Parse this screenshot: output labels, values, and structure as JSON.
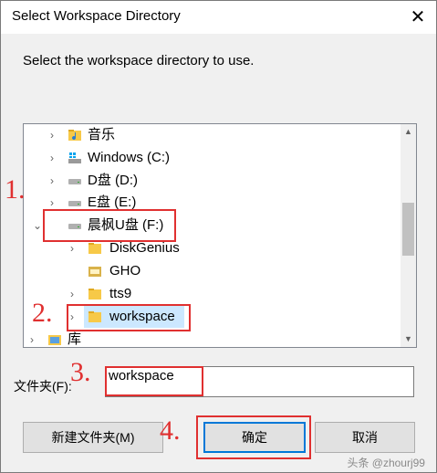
{
  "window": {
    "title": "Select Workspace Directory",
    "close_glyph": "✕"
  },
  "prompt": "Select the workspace directory to use.",
  "tree": {
    "items": [
      {
        "label": "音乐",
        "icon": "music-folder-icon",
        "chevron": "›"
      },
      {
        "label": "Windows (C:)",
        "icon": "windows-drive-icon",
        "chevron": "›"
      },
      {
        "label": "D盘 (D:)",
        "icon": "drive-icon",
        "chevron": "›"
      },
      {
        "label": "E盘 (E:)",
        "icon": "drive-icon",
        "chevron": "›"
      },
      {
        "label": "晨枫U盘 (F:)",
        "icon": "usb-drive-icon",
        "chevron": "⌄"
      },
      {
        "label": "DiskGenius",
        "icon": "folder-icon",
        "chevron": "›"
      },
      {
        "label": "GHO",
        "icon": "gho-folder-icon",
        "chevron": ""
      },
      {
        "label": "tts9",
        "icon": "folder-icon",
        "chevron": "›"
      },
      {
        "label": "workspace",
        "icon": "folder-icon",
        "chevron": "›",
        "selected": true
      },
      {
        "label": "库",
        "icon": "library-icon",
        "chevron": "›"
      }
    ],
    "scroll_up": "▲",
    "scroll_down": "▼"
  },
  "folder": {
    "label": "文件夹(F):",
    "value": "workspace"
  },
  "buttons": {
    "new_folder": "新建文件夹(M)",
    "ok": "确定",
    "cancel": "取消"
  },
  "annotations": [
    "1.",
    "2.",
    "3.",
    "4."
  ],
  "watermark": "头条 @zhourj99",
  "colors": {
    "annotation": "#e03030",
    "selection": "#cce8ff",
    "default_button_border": "#0078d7",
    "folder_yellow": "#f7c948"
  }
}
